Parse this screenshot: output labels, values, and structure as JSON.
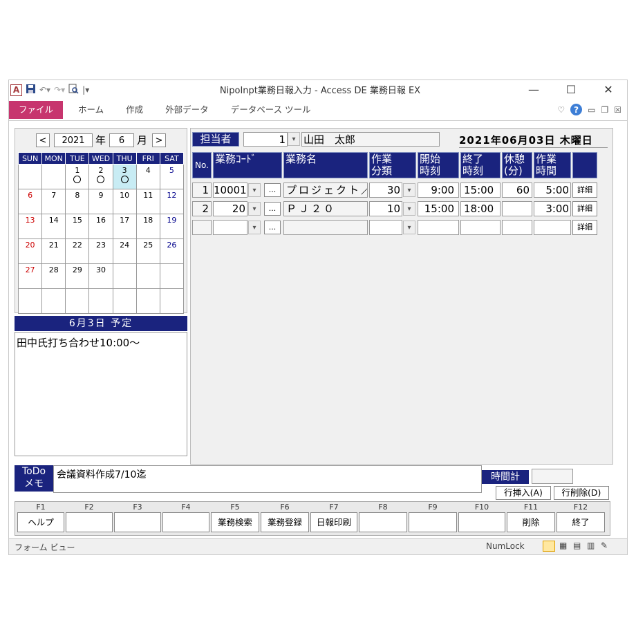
{
  "window": {
    "title": "NipoInpt業務日報入力 - Access DE 業務日報 EX",
    "app_icon": "A"
  },
  "ribbon": {
    "tabs": [
      "ファイル",
      "ホーム",
      "作成",
      "外部データ",
      "データベース ツール"
    ]
  },
  "calendar": {
    "year": "2021",
    "year_unit": "年",
    "month": "6",
    "month_unit": "月",
    "prev": "<",
    "next": ">",
    "weekdays": [
      "SUN",
      "MON",
      "TUE",
      "WED",
      "THU",
      "FRI",
      "SAT"
    ],
    "weeks": [
      [
        "",
        "",
        "1",
        "2",
        "3",
        "4",
        "5"
      ],
      [
        "6",
        "7",
        "8",
        "9",
        "10",
        "11",
        "12"
      ],
      [
        "13",
        "14",
        "15",
        "16",
        "17",
        "18",
        "19"
      ],
      [
        "20",
        "21",
        "22",
        "23",
        "24",
        "25",
        "26"
      ],
      [
        "27",
        "28",
        "29",
        "30",
        "",
        "",
        ""
      ],
      [
        "",
        "",
        "",
        "",
        "",
        "",
        ""
      ]
    ]
  },
  "schedule": {
    "header": "6月3日 予定",
    "text": "田中氏打ち合わせ10:00～"
  },
  "staff": {
    "label": "担当者",
    "id": "1",
    "name": "山田　太郎"
  },
  "date_display": "2021年06月03日 木曜日",
  "grid": {
    "headers": {
      "no": "No.",
      "code": "業務ｺｰﾄﾞ",
      "name": "業務名",
      "cat1": "作業",
      "cat2": "分類",
      "start1": "開始",
      "start2": "時刻",
      "end1": "終了",
      "end2": "時刻",
      "rest1": "休憩",
      "rest2": "(分)",
      "work1": "作業",
      "work2": "時間"
    },
    "rows": [
      {
        "no": "1",
        "code": "10001",
        "name": "プロジェクト／",
        "cat": "30",
        "start": "9:00",
        "end": "15:00",
        "rest": "60",
        "work": "5:00",
        "detail": "詳細"
      },
      {
        "no": "2",
        "code": "20",
        "name": "ＰＪ２０",
        "cat": "10",
        "start": "15:00",
        "end": "18:00",
        "rest": "",
        "work": "3:00",
        "detail": "詳細"
      },
      {
        "no": "",
        "code": "",
        "name": "",
        "cat": "",
        "start": "",
        "end": "",
        "rest": "",
        "work": "",
        "detail": "詳細"
      }
    ],
    "dots": "..."
  },
  "todo": {
    "label1": "ToDo",
    "label2": "メモ",
    "text": "会議資料作成7/10迄"
  },
  "time_total": {
    "label": "時間計",
    "value": ""
  },
  "row_buttons": {
    "insert": "行挿入(A)",
    "delete": "行削除(D)"
  },
  "function_keys": [
    {
      "key": "F1",
      "label": "ヘルプ"
    },
    {
      "key": "F2",
      "label": ""
    },
    {
      "key": "F3",
      "label": ""
    },
    {
      "key": "F4",
      "label": ""
    },
    {
      "key": "F5",
      "label": "業務検索"
    },
    {
      "key": "F6",
      "label": "業務登録"
    },
    {
      "key": "F7",
      "label": "日報印刷"
    },
    {
      "key": "F8",
      "label": ""
    },
    {
      "key": "F9",
      "label": ""
    },
    {
      "key": "F10",
      "label": ""
    },
    {
      "key": "F11",
      "label": "削除"
    },
    {
      "key": "F12",
      "label": "終了"
    }
  ],
  "status": {
    "left": "フォーム ビュー",
    "numlock": "NumLock"
  },
  "colors": {
    "header_navy": "#1a237e",
    "file_tab": "#c7356e",
    "today_highlight": "#c8ecf4"
  }
}
